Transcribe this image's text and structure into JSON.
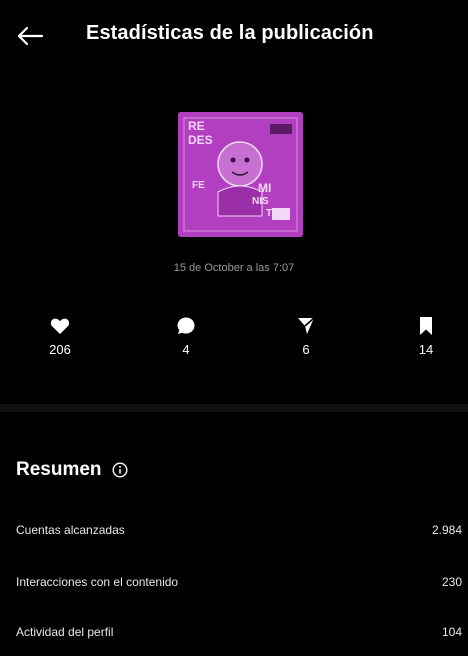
{
  "header": {
    "title": "Estadísticas de la publicación",
    "back_icon": "arrow-left-icon"
  },
  "post": {
    "thumbnail_words": [
      "RE",
      "DES",
      "FE",
      "MI",
      "NIS",
      "TAS"
    ],
    "date": "15 de October a las 7:07",
    "accent_color": "#b23fc0"
  },
  "stats": {
    "likes": {
      "icon": "heart-icon",
      "value": "206"
    },
    "comments": {
      "icon": "comment-icon",
      "value": "4"
    },
    "shares": {
      "icon": "send-icon",
      "value": "6"
    },
    "saves": {
      "icon": "bookmark-icon",
      "value": "14"
    }
  },
  "summary": {
    "title": "Resumen",
    "rows": [
      {
        "label": "Cuentas alcanzadas",
        "value": "2.984"
      },
      {
        "label": "Interacciones con el contenido",
        "value": "230"
      },
      {
        "label": "Actividad del perfil",
        "value": "104"
      }
    ]
  }
}
